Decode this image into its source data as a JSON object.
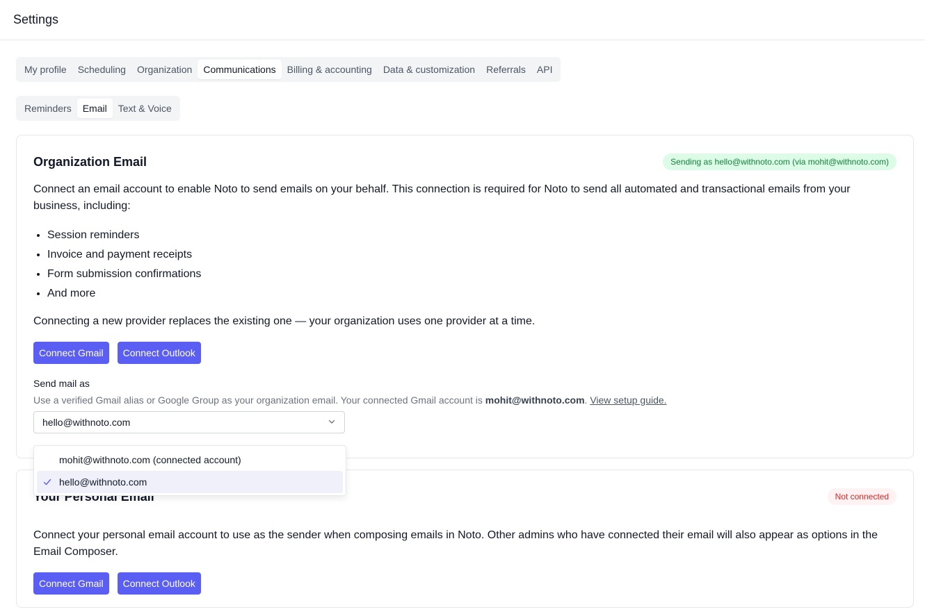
{
  "header": {
    "title": "Settings"
  },
  "main_tabs": [
    {
      "label": "My profile",
      "active": false
    },
    {
      "label": "Scheduling",
      "active": false
    },
    {
      "label": "Organization",
      "active": false
    },
    {
      "label": "Communications",
      "active": true
    },
    {
      "label": "Billing & accounting",
      "active": false
    },
    {
      "label": "Data & customization",
      "active": false
    },
    {
      "label": "Referrals",
      "active": false
    },
    {
      "label": "API",
      "active": false
    }
  ],
  "sub_tabs": [
    {
      "label": "Reminders",
      "active": false
    },
    {
      "label": "Email",
      "active": true
    },
    {
      "label": "Text & Voice",
      "active": false
    }
  ],
  "org_email": {
    "title": "Organization Email",
    "status": "Sending as hello@withnoto.com (via mohit@withnoto.com)",
    "description": "Connect an email account to enable Noto to send emails on your behalf. This connection is required for Noto to send all automated and transactional emails from your business, including:",
    "bullets": [
      "Session reminders",
      "Invoice and payment receipts",
      "Form submission confirmations",
      "And more"
    ],
    "note": "Connecting a new provider replaces the existing one — your organization uses one provider at a time.",
    "connect_gmail": "Connect Gmail",
    "connect_outlook": "Connect Outlook",
    "send_as_label": "Send mail as",
    "helper_prefix": "Use a verified Gmail alias or Google Group as your organization email. Your connected Gmail account is ",
    "helper_account": "mohit@withnoto.com",
    "helper_suffix": ". ",
    "helper_link": "View setup guide.",
    "selected_value": "hello@withnoto.com",
    "options": [
      {
        "label": "mohit@withnoto.com (connected account)",
        "selected": false
      },
      {
        "label": "hello@withnoto.com",
        "selected": true
      }
    ]
  },
  "personal_email": {
    "title": "Your Personal Email",
    "status": "Not connected",
    "description": "Connect your personal email account to use as the sender when composing emails in Noto. Other admins who have connected their email will also appear as options in the Email Composer.",
    "connect_gmail": "Connect Gmail",
    "connect_outlook": "Connect Outlook"
  },
  "colors": {
    "primary": "#5b5ef2",
    "success_bg": "#dcfce7",
    "success_text": "#15803d",
    "danger_bg": "#fef2f2",
    "danger_text": "#dc2626"
  },
  "icons": {
    "select_chevron": "chevron-down-icon",
    "selected_check": "check-icon"
  }
}
